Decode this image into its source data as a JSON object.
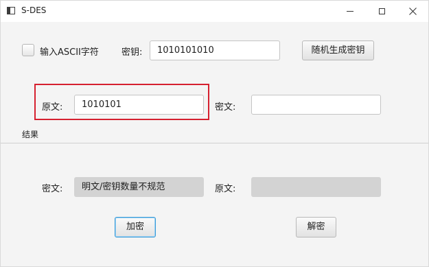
{
  "window": {
    "title": "S-DES"
  },
  "settings": {
    "ascii_checkbox_label": "输入ASCII字符",
    "ascii_checked": false,
    "key_label": "密钥:",
    "key_value": "1010101010",
    "random_key_button": "随机生成密钥"
  },
  "encrypt_input": {
    "plaintext_label": "原文:",
    "plaintext_value": "1010101"
  },
  "decrypt_input": {
    "ciphertext_label": "密文:",
    "ciphertext_value": ""
  },
  "results": {
    "section_label": "结果",
    "ciphertext_label": "密文:",
    "ciphertext_value": "明文/密钥数量不规范",
    "plaintext_label": "原文:",
    "plaintext_value": ""
  },
  "actions": {
    "encrypt_button": "加密",
    "decrypt_button": "解密"
  }
}
